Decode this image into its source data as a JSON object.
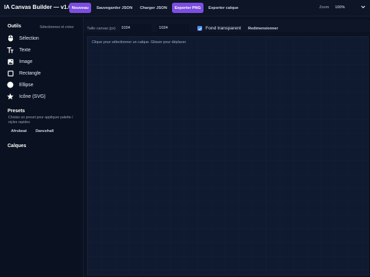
{
  "app": {
    "title": "IA Canvas Builder — v1.0"
  },
  "toolbar": {
    "buttons": [
      {
        "label": "Nouveau",
        "primary": true
      },
      {
        "label": "Sauvegarder JSON",
        "primary": false
      },
      {
        "label": "Charger JSON",
        "primary": false
      },
      {
        "label": "Exporter PNG",
        "primary": true
      },
      {
        "label": "Exporter calque",
        "primary": false
      }
    ],
    "zoom_label": "Zoom",
    "zoom_value": "100%"
  },
  "sidebar": {
    "tools_title": "Outils",
    "tools_hint": "Sélectionnez et créez",
    "tools": [
      {
        "label": "Sélection",
        "icon": "mouse-icon"
      },
      {
        "label": "Texte",
        "icon": "text-icon"
      },
      {
        "label": "Image",
        "icon": "image-icon"
      },
      {
        "label": "Rectangle",
        "icon": "rectangle-icon"
      },
      {
        "label": "Ellipse",
        "icon": "ellipse-icon"
      },
      {
        "label": "Icône (SVG)",
        "icon": "star-icon"
      }
    ],
    "presets_title": "Presets",
    "presets_desc": "Choisis un preset pour appliquer palette / styles rapides",
    "presets": [
      "Afrobeat",
      "Dancehall"
    ],
    "layers_title": "Calques"
  },
  "canvas": {
    "size_label": "Taille canvas (px)",
    "width": "1024",
    "height": "1024",
    "transparent_label": "Fond transparent",
    "transparent_checked": true,
    "resize_label": "Redimensionner",
    "hint": "Clique pour sélectionner un calque. Glisser pour déplacer."
  },
  "colors": {
    "accent": "#7c4ee0",
    "checkbox": "#4c8df6",
    "background": "#0b1222"
  }
}
